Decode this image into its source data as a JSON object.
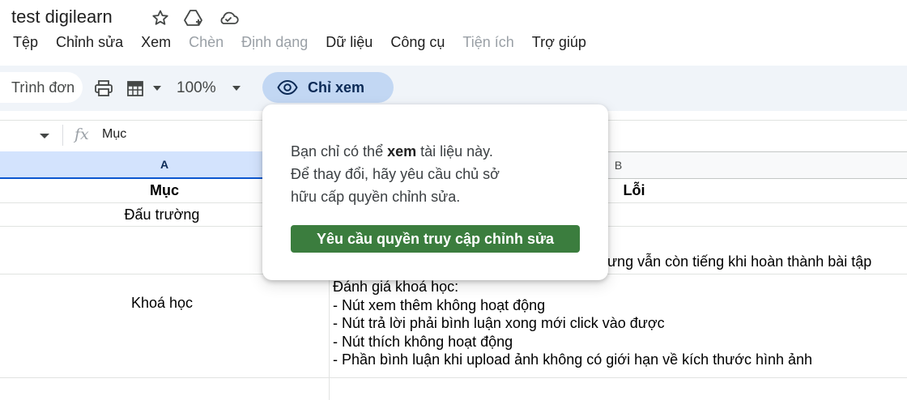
{
  "doc": {
    "title": "test digilearn"
  },
  "menu": [
    "Tệp",
    "Chỉnh sửa",
    "Xem",
    "Chèn",
    "Định dạng",
    "Dữ liệu",
    "Công cụ",
    "Tiện ích",
    "Trợ giúp"
  ],
  "menu_disabled": [
    false,
    false,
    false,
    true,
    true,
    false,
    false,
    true,
    false
  ],
  "toolbar": {
    "menu_search": "Trình đơn",
    "zoom": "100%",
    "view_only_label": "Chỉ xem"
  },
  "formula_bar": {
    "fx": "fx",
    "value": "Mục"
  },
  "columns": {
    "a": "A",
    "b": "B"
  },
  "table": {
    "header_a": "Mục",
    "header_b": "Lỗi",
    "row1_a": "Đấu trường",
    "row2_b_partial": "hưng vẫn còn tiếng khi hoàn thành bài tập",
    "row3_a": "Khoá học",
    "row3_b_lines": [
      "Đánh giá khoá học:",
      "- Nút xem thêm không hoạt động",
      "- Nút trả lời phải bình luận xong mới click vào được",
      "- Nút thích không hoạt động",
      "- Phần bình luận khi upload ảnh không có giới hạn về kích thước hình ảnh"
    ]
  },
  "popup": {
    "line1_before": "Bạn chỉ có thể ",
    "line1_bold": "xem",
    "line1_after": " tài liệu này.",
    "line2": "Để thay đổi, hãy yêu cầu chủ sở",
    "line3": "hữu cấp quyền chỉnh sửa.",
    "button": "Yêu cầu quyền truy cập chỉnh sửa"
  },
  "colors": {
    "accent_view": "#c2d7f3",
    "button_green": "#3b7d3e",
    "selected_col": "#d3e3fd"
  }
}
